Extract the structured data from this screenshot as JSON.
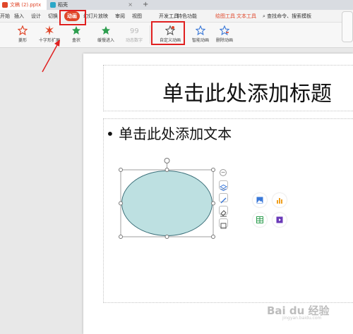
{
  "tabs": [
    {
      "label": "文稿 (2).pptx",
      "active": true
    },
    {
      "label": "稻壳",
      "active": false
    }
  ],
  "new_tab_label": "+",
  "menu": {
    "items": [
      "开始",
      "插入",
      "设计",
      "切换",
      "动画",
      "幻灯片放映",
      "审阅",
      "视图",
      "开发工具",
      "特色功能",
      "绘图工具",
      "文本工具"
    ],
    "active": "动画",
    "search_label": "查找命令、搜索模板"
  },
  "ribbon": {
    "buttons": [
      "菱形",
      "十字形扩展",
      "盒状",
      "缓慢进入",
      "动态数字",
      "自定义动画",
      "智能动画",
      "删除动画"
    ]
  },
  "slide": {
    "title_placeholder": "单击此处添加标题",
    "body_placeholder": "单击此处添加文本",
    "bullet": "•"
  },
  "shape": {
    "type": "ellipse",
    "fill": "#bde0e1",
    "stroke": "#3a6e78"
  },
  "colors": {
    "accent": "#e0472a",
    "highlight_box": "#e02020"
  },
  "watermark": {
    "text": "Bai du 经验",
    "sub": "jingyan.baidu.com"
  }
}
